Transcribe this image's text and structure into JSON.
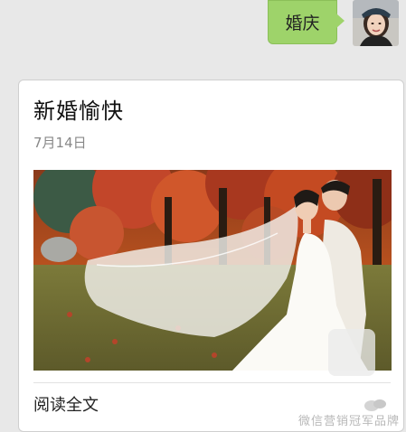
{
  "chat": {
    "outgoing_message": "婚庆"
  },
  "article": {
    "title": "新婚愉快",
    "date": "7月14日",
    "read_more": "阅读全文"
  },
  "watermark": {
    "text": "微信营销冠军品牌"
  },
  "colors": {
    "background": "#e8e8e8",
    "bubble": "#9ed36a",
    "card": "#ffffff",
    "date_text": "#888888"
  },
  "icons": {
    "avatar": "user-photo-avatar",
    "cover": "wedding-couple-photo",
    "watermark_logo": "logo-icon"
  }
}
